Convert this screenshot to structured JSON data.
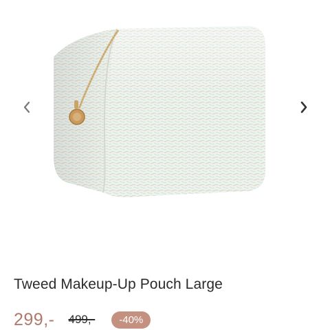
{
  "gallery": {
    "image_icon": "tweed-makeup-pouch-image",
    "prev_icon": "chevron-left-icon",
    "next_icon": "chevron-right-icon"
  },
  "product": {
    "title": "Tweed Makeup-Up Pouch Large",
    "price": "299,-",
    "old_price": "499,-",
    "discount": "-40%"
  },
  "colors": {
    "price": "#b07a6a",
    "badge": "#c49080",
    "text": "#2b2b2b"
  }
}
